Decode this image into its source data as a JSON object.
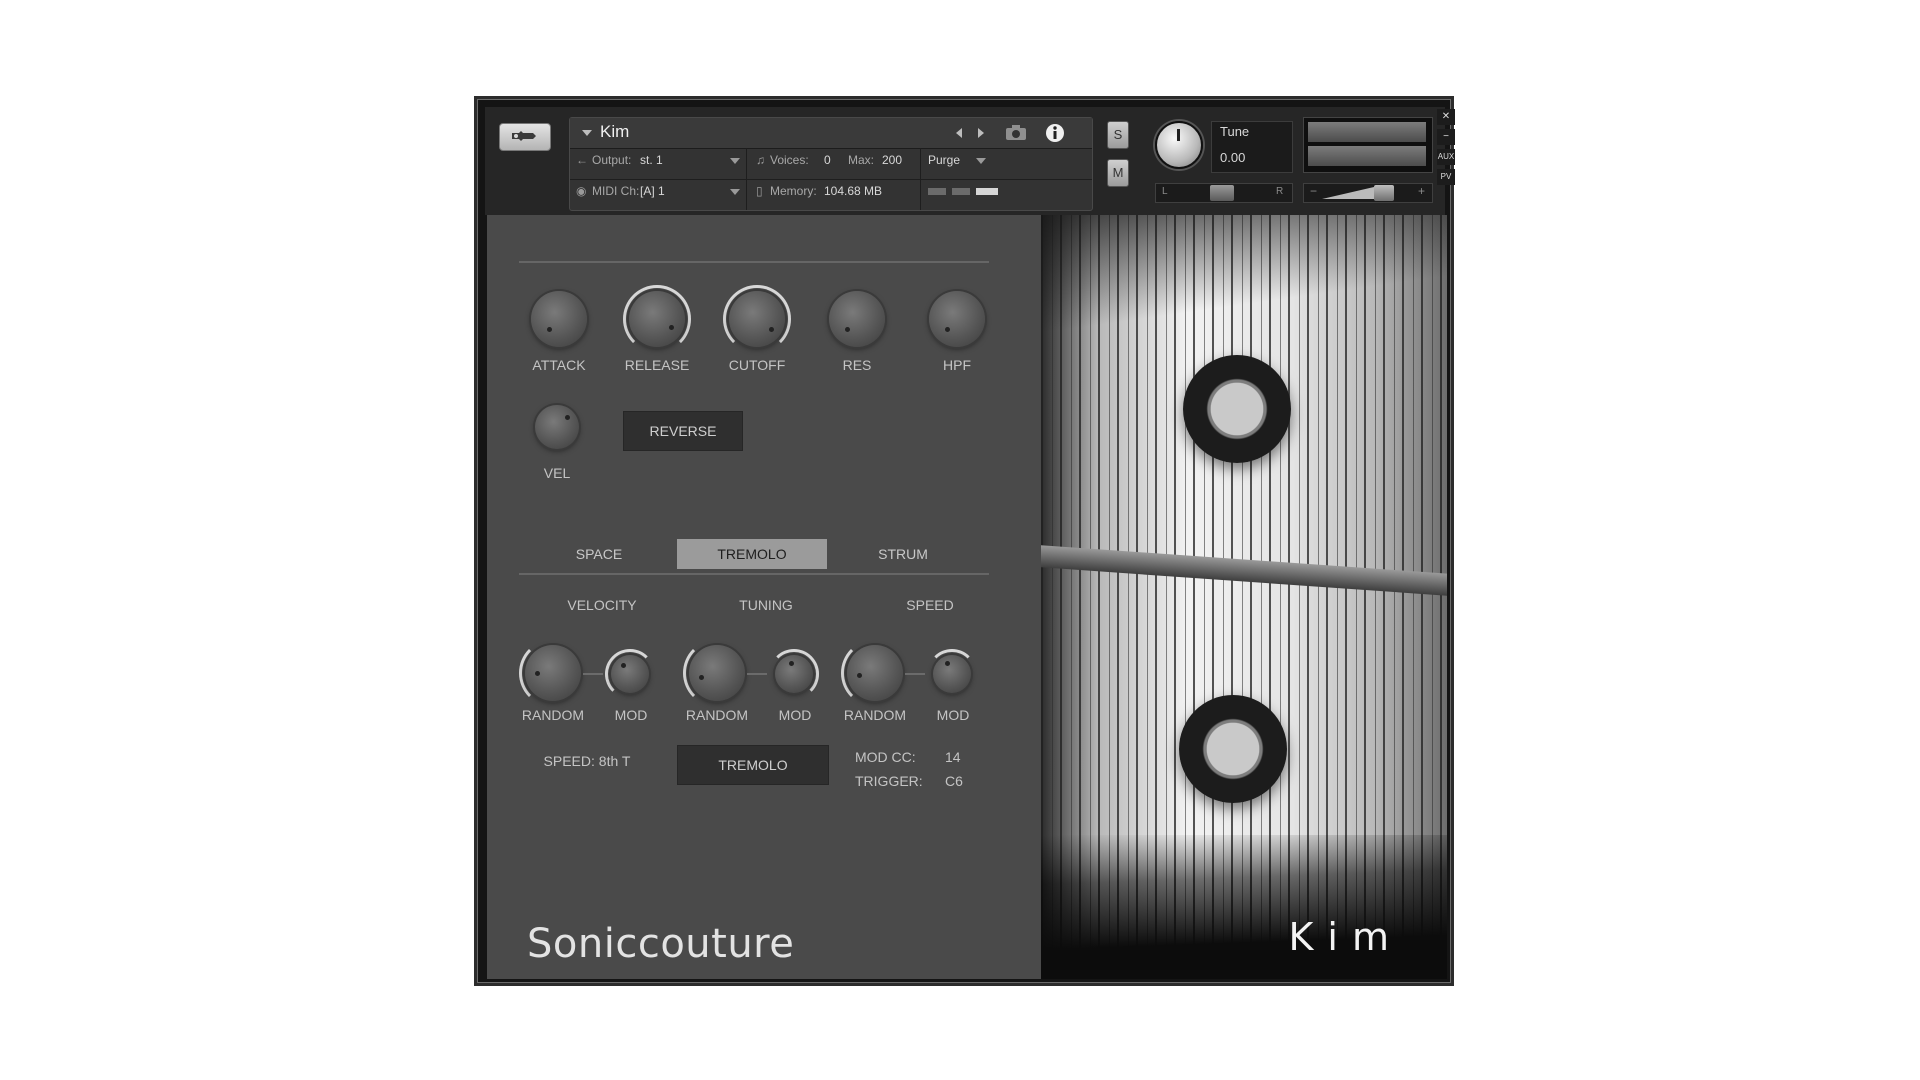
{
  "header": {
    "instrument_name": "Kim",
    "output_label": "Output:",
    "output_value": "st. 1",
    "voices_label": "Voices:",
    "voices_value": "0",
    "max_label": "Max:",
    "max_value": "200",
    "purge_label": "Purge",
    "midi_label": "MIDI Ch:",
    "midi_value": "[A]  1",
    "memory_label": "Memory:",
    "memory_value": "104.68 MB",
    "solo_label": "S",
    "mute_label": "M",
    "tune_label": "Tune",
    "tune_value": "0.00",
    "pan_left": "L",
    "pan_right": "R",
    "vol_minus": "−",
    "vol_plus": "+",
    "aux_label": "AUX",
    "pv_label": "PV",
    "close_symbol": "✕",
    "minimize_symbol": "−"
  },
  "knobs_top": [
    {
      "label": "ATTACK"
    },
    {
      "label": "RELEASE"
    },
    {
      "label": "CUTOFF"
    },
    {
      "label": "RES"
    },
    {
      "label": "HPF"
    }
  ],
  "vel": {
    "label": "VEL"
  },
  "reverse_button": "REVERSE",
  "tabs": [
    "SPACE",
    "TREMOLO",
    "STRUM"
  ],
  "active_tab": "TREMOLO",
  "groups": [
    {
      "title": "VELOCITY",
      "random_label": "RANDOM",
      "mod_label": "MOD"
    },
    {
      "title": "TUNING",
      "random_label": "RANDOM",
      "mod_label": "MOD"
    },
    {
      "title": "SPEED",
      "random_label": "RANDOM",
      "mod_label": "MOD"
    }
  ],
  "speed_text": "SPEED: 8th T",
  "tremolo_button": "TREMOLO",
  "modcc_label": "MOD CC:",
  "modcc_value": "14",
  "trigger_label": "TRIGGER:",
  "trigger_value": "C6",
  "brand": "Soniccouture",
  "artwork_title": "Kim"
}
